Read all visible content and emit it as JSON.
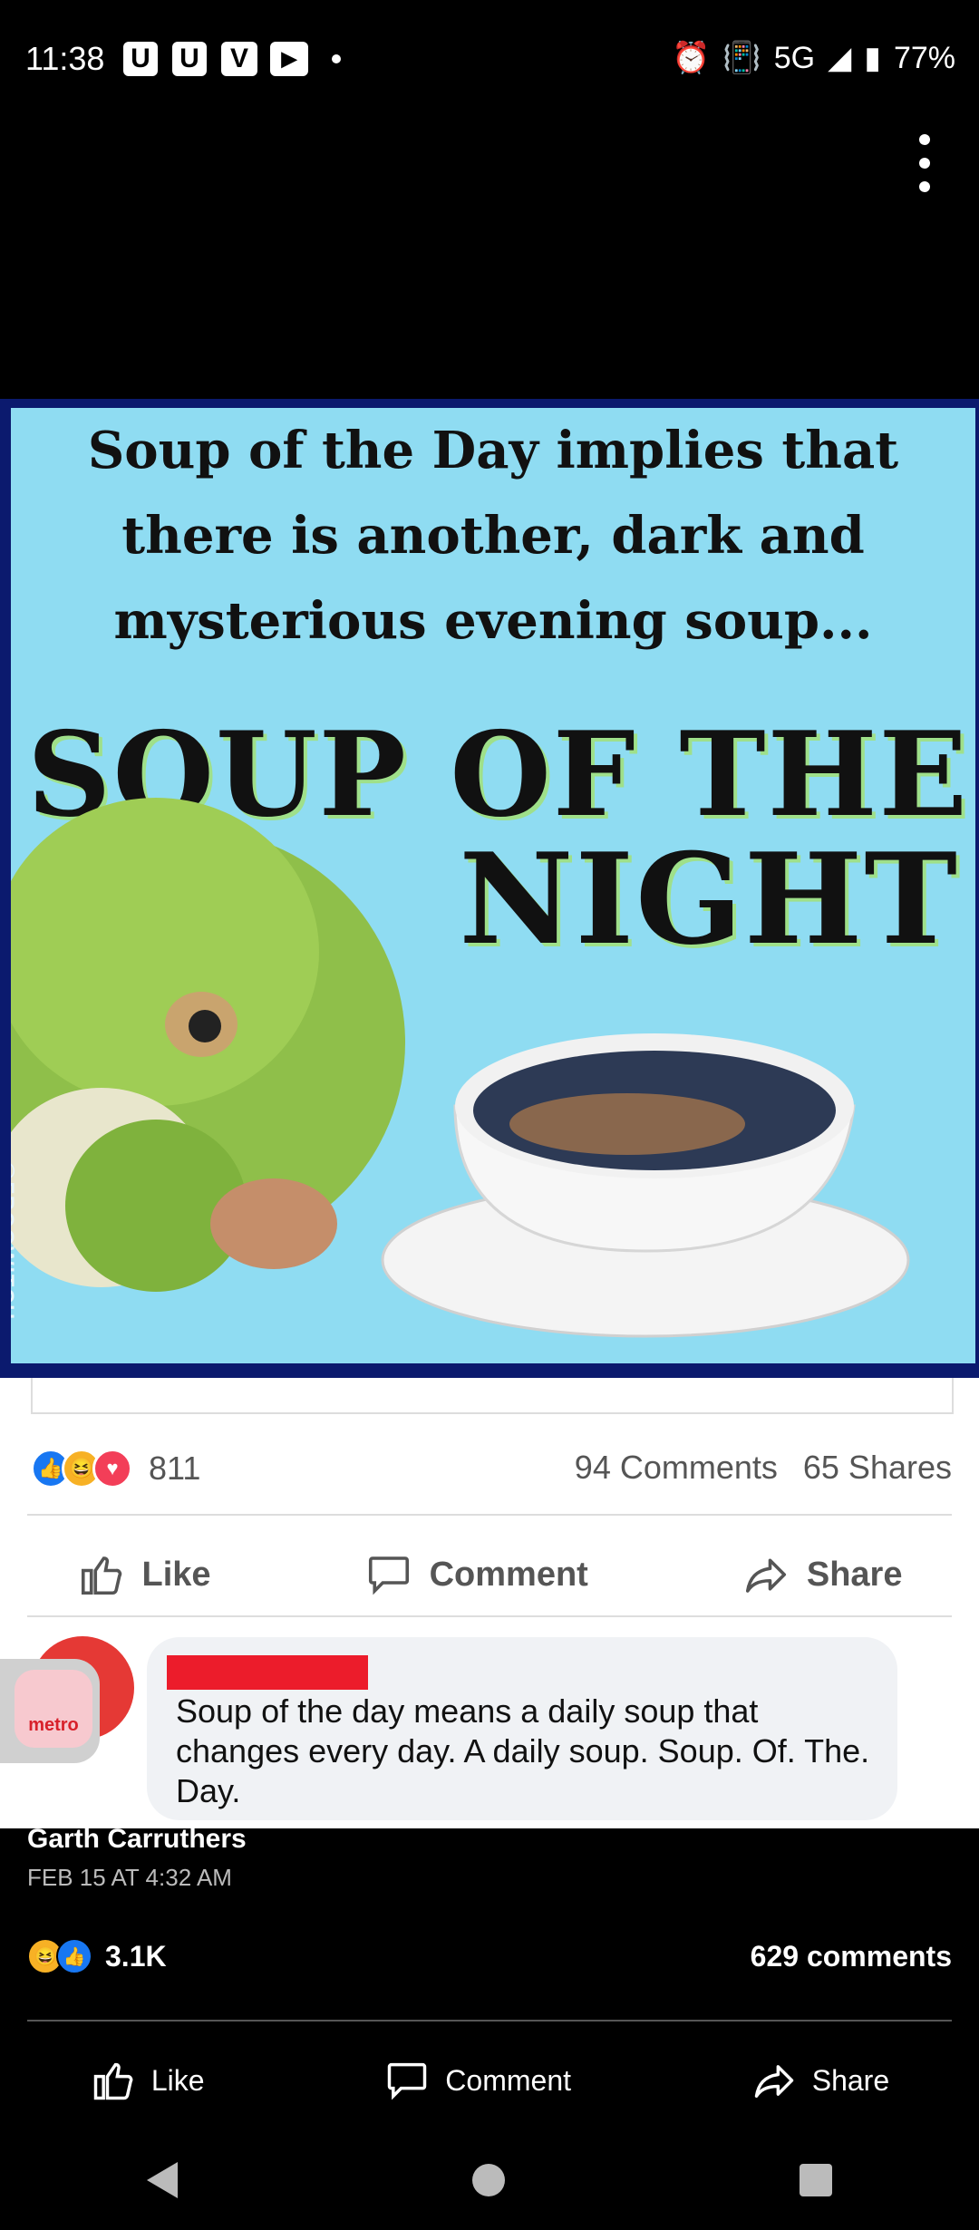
{
  "status_bar": {
    "time": "11:38",
    "notifications": [
      "U",
      "U",
      "V",
      "▶"
    ],
    "network": "5G",
    "battery": "77%"
  },
  "meme": {
    "top_text_lines": [
      "Soup of the Day implies that",
      "there is another, dark and",
      "mysterious evening soup..."
    ],
    "headline_1": "SOUP OF THE",
    "headline_2": "NIGHT",
    "watermark": "@FROGWITCH"
  },
  "post": {
    "reaction_count": "811",
    "comments": "94 Comments",
    "shares": "65 Shares",
    "like_label": "Like",
    "comment_label": "Comment",
    "share_label": "Share",
    "comment_text": "Soup of the day means a daily soup that changes every day. A daily soup. Soup. Of. The. Day.",
    "metro_label": "metro"
  },
  "shared_by": {
    "author": "Garth Carruthers",
    "date": "FEB 15 AT 4:32 AM",
    "reaction_count": "3.1K",
    "comments": "629 comments",
    "like_label": "Like",
    "comment_label": "Comment",
    "share_label": "Share"
  },
  "colors": {
    "like_blue": "#1877f2",
    "haha_yellow": "#f7b125",
    "love_red": "#f33e58",
    "meme_bg": "#8fdcf2",
    "redaction": "#ec1c2b"
  }
}
